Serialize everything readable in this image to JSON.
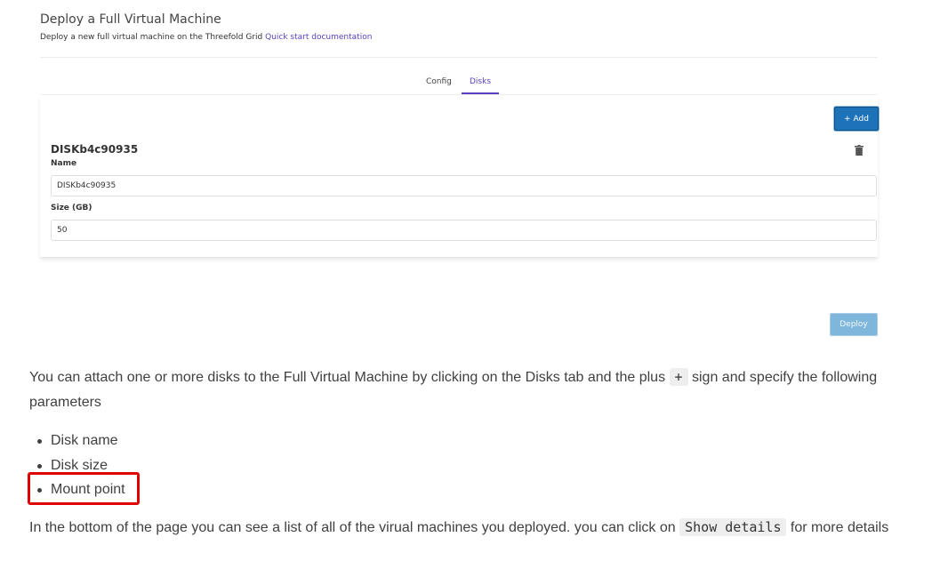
{
  "screenshot": {
    "title": "Deploy a Full Virtual Machine",
    "subtitle": "Deploy a new full virtual machine on the Threefold Grid",
    "doc_link": "Quick start documentation",
    "tabs": [
      {
        "label": "Config",
        "active": false
      },
      {
        "label": "Disks",
        "active": true
      }
    ],
    "add_button": "+ Add",
    "disk": {
      "title": "DISKb4c90935",
      "name_label": "Name",
      "name_value": "DISKb4c90935",
      "size_label": "Size (GB)",
      "size_value": "50"
    },
    "deploy_button": "Deploy",
    "icons": {
      "delete": "trash-icon"
    },
    "colors": {
      "accent": "#5a3fc0",
      "primary_button": "#1d72b8",
      "disabled_button": "#7fb6dc"
    }
  },
  "doc": {
    "paragraph1_before": "You can attach one or more disks to the Full Virtual Machine by clicking on the Disks tab and the plus ",
    "paragraph1_code": "+",
    "paragraph1_after": " sign and specify the following parameters",
    "list": [
      "Disk name",
      "Disk size",
      "Mount point"
    ],
    "highlighted_item": "Mount point",
    "paragraph2_before": "In the bottom of the page you can see a list of all of the virual machines you deployed. you can click on ",
    "paragraph2_code": "Show details",
    "paragraph2_after": " for more details",
    "highlight_color": "#e00000"
  }
}
